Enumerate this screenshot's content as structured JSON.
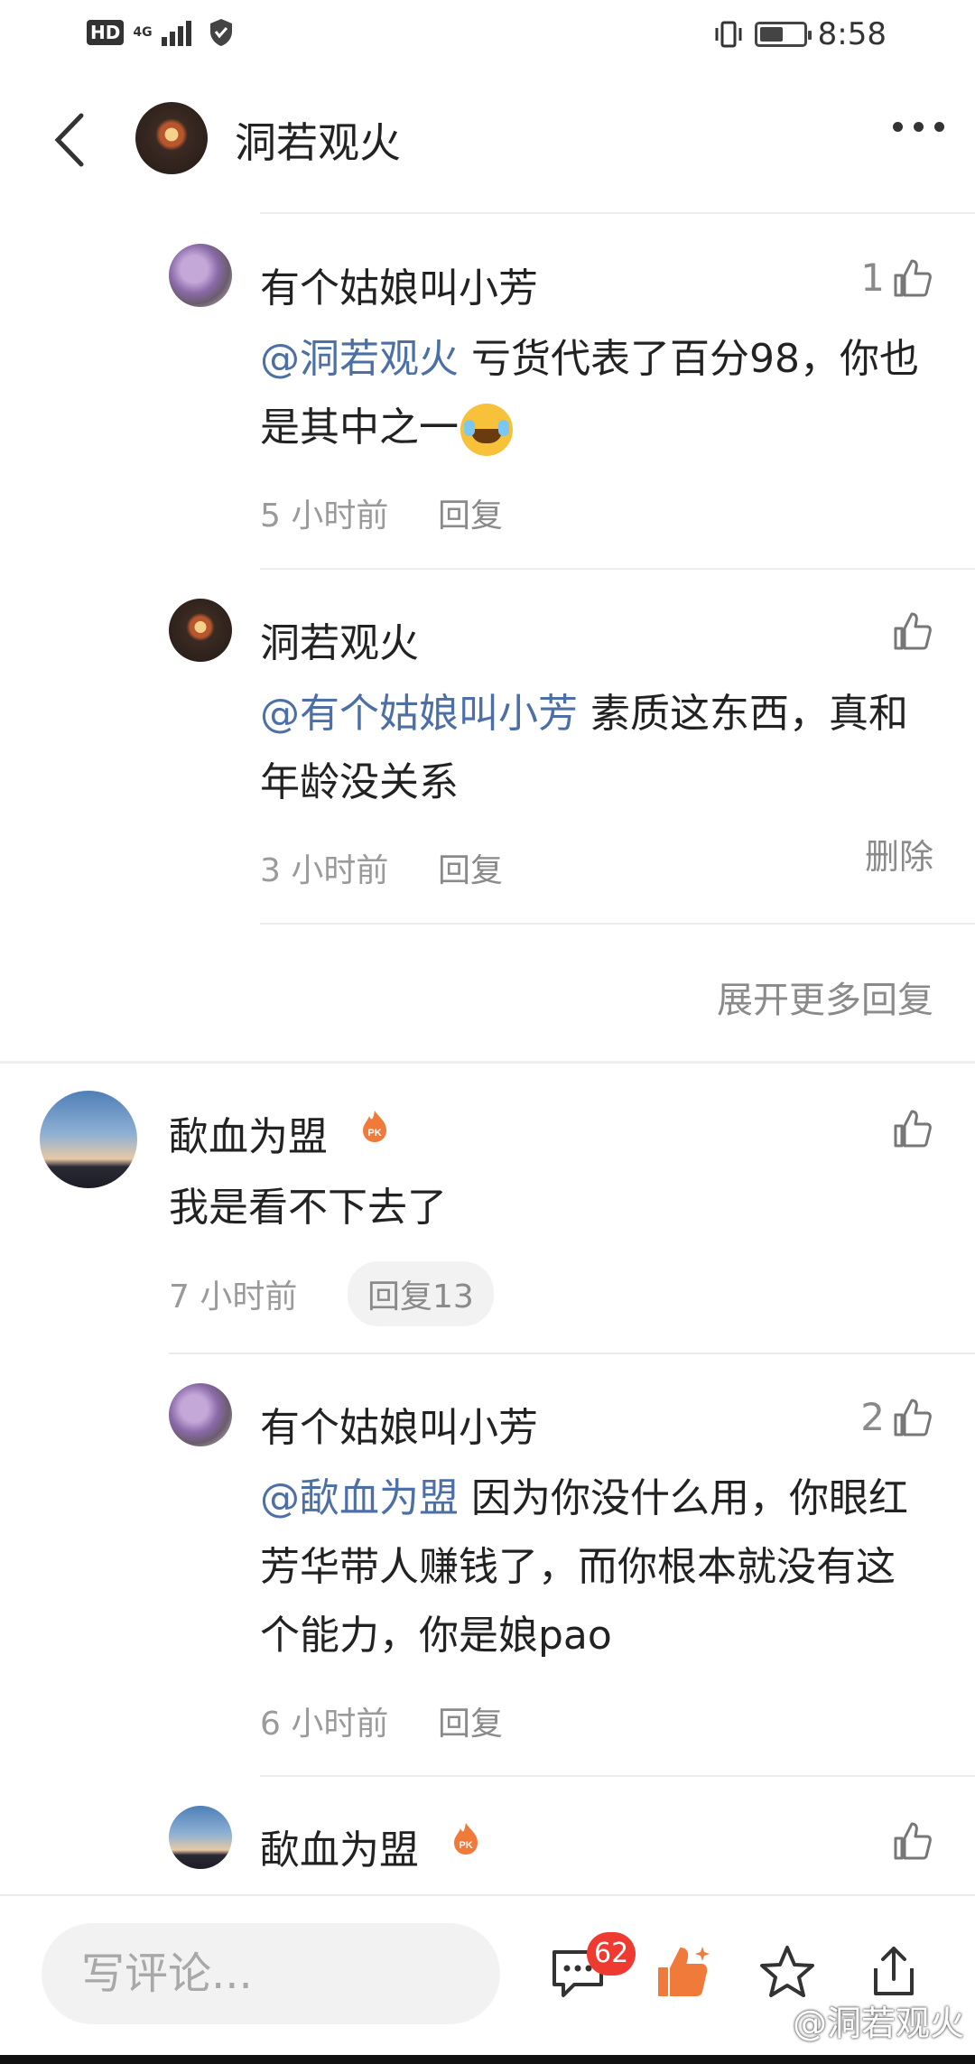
{
  "status_bar": {
    "hd": "HD",
    "network": "4G",
    "time": "8:58",
    "battery_level": 0.55
  },
  "header": {
    "title": "洞若观火"
  },
  "comments": [
    {
      "name": "有个姑娘叫小芳",
      "likes": "1",
      "mention": "@洞若观火",
      "text": " 亏货代表了百分98，你也是其中之一",
      "emoji": "face-with-tears-of-joy",
      "time": "5 小时前",
      "reply": "回复"
    },
    {
      "name": "洞若观火",
      "likes": "",
      "mention": "@有个姑娘叫小芳",
      "text": " 素质这东西，真和年龄没关系",
      "time": "3 小时前",
      "reply": "回复",
      "delete": "删除"
    },
    {
      "expand": "展开更多回复"
    },
    {
      "name": "歃血为盟",
      "likes": "",
      "text": "我是看不下去了",
      "time": "7 小时前",
      "reply": "回复13"
    },
    {
      "name": "有个姑娘叫小芳",
      "likes": "2",
      "mention": "@歃血为盟",
      "text": " 因为你没什么用，你眼红芳华带人赚钱了，而你根本就没有这个能力，你是娘pao",
      "time": "6 小时前",
      "reply": "回复"
    },
    {
      "name": "歃血为盟",
      "likes": ""
    }
  ],
  "bottom_bar": {
    "placeholder": "写评论...",
    "comment_count": "62",
    "watermark": "@洞若观火",
    "accent_color": "#f07a3a"
  }
}
